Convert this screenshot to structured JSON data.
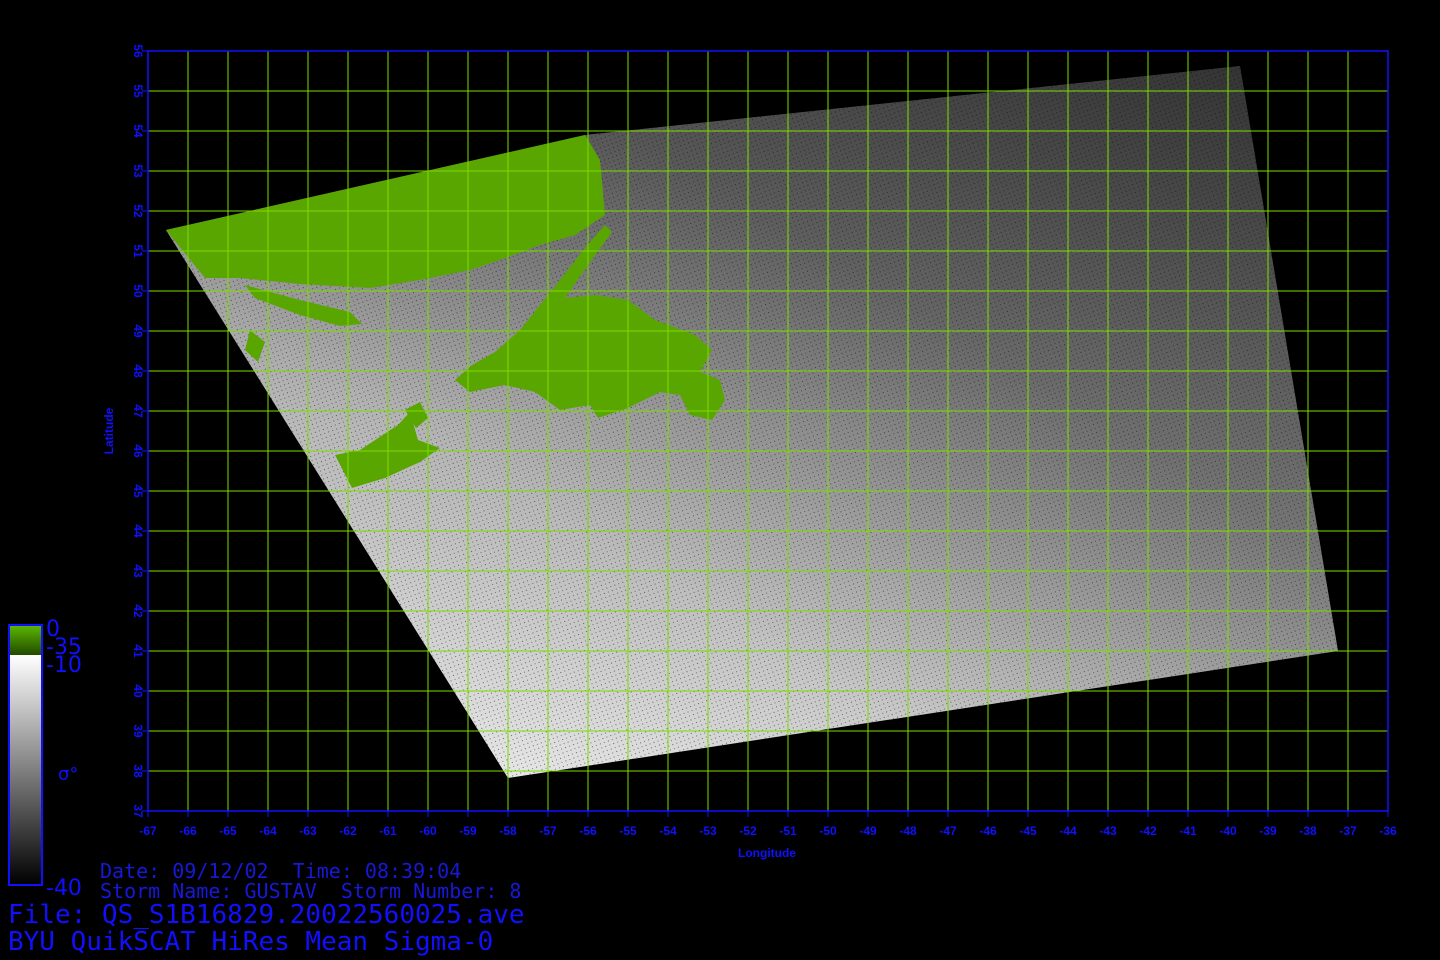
{
  "colors": {
    "axis": "#1010ff",
    "grid": "#7cdc00",
    "land": "#5aa600",
    "background": "#000000"
  },
  "map": {
    "x_axis": {
      "title": "Longitude",
      "range": [
        -67,
        -36
      ],
      "ticks": [
        "-67",
        "-66",
        "-65",
        "-64",
        "-63",
        "-62",
        "-61",
        "-60",
        "-59",
        "-58",
        "-57",
        "-56",
        "-55",
        "-54",
        "-53",
        "-52",
        "-51",
        "-50",
        "-49",
        "-48",
        "-47",
        "-46",
        "-45",
        "-44",
        "-43",
        "-42",
        "-41",
        "-40",
        "-39",
        "-38",
        "-37",
        "-36"
      ]
    },
    "y_axis": {
      "title": "Latitude",
      "range": [
        37,
        56
      ],
      "ticks": [
        "37",
        "38",
        "39",
        "40",
        "41",
        "42",
        "43",
        "44",
        "45",
        "46",
        "47",
        "48",
        "49",
        "50",
        "51",
        "52",
        "53",
        "54",
        "55",
        "56"
      ]
    },
    "grid": true
  },
  "colorbar": {
    "land_top": "0",
    "land_bottom": "-35",
    "ocean_top": "-10",
    "ocean_bottom": "-40",
    "symbol": "σ°"
  },
  "info": {
    "date_line": "Date: 09/12/02  Time: 08:39:04",
    "storm_line": "Storm Name: GUSTAV  Storm Number: 8",
    "file_line": "File: QS_S1B16829.20022560025.ave",
    "product_line": "BYU QuikSCAT HiRes Mean Sigma-0"
  }
}
